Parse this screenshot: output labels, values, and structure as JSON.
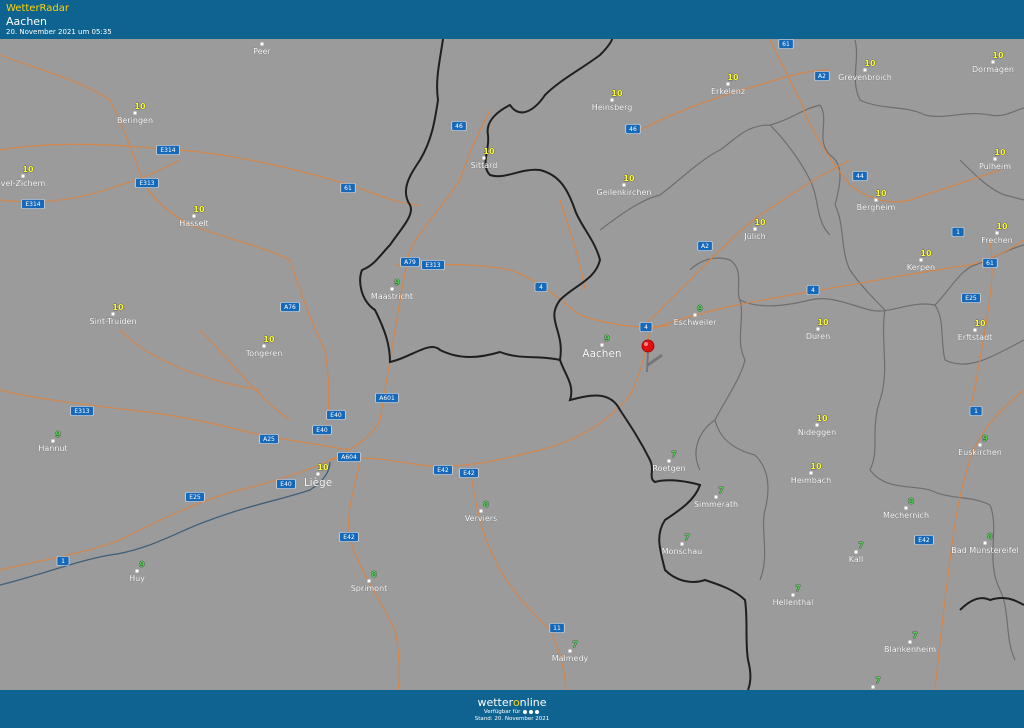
{
  "header": {
    "app_title": "WetterRadar",
    "location": "Aachen",
    "timestamp": "20. November 2021 um 05:35"
  },
  "footer": {
    "brand_left": "wetter",
    "brand_o": "o",
    "brand_right": "nline",
    "available": "Verfügbar für",
    "stand": "Stand: 20. November 2021"
  },
  "colors": {
    "bar": "#0e6390",
    "accent": "#ffd400",
    "value_yellow": "#ffff33",
    "value_green": "#4cd14c",
    "road": "#d4864a",
    "border": "#222222",
    "region": "#6e6e6e"
  },
  "marker_icon": "map-pin-icon",
  "cities": [
    {
      "name": "Peer",
      "value": ""
    },
    {
      "name": "Beringen",
      "value": "10"
    },
    {
      "name": "vel-Zichem",
      "value": "10"
    },
    {
      "name": "Hasselt",
      "value": "10"
    },
    {
      "name": "Sint-Truiden",
      "value": "10"
    },
    {
      "name": "Tongeren",
      "value": "10"
    },
    {
      "name": "Hannut",
      "value": "9"
    },
    {
      "name": "Huy",
      "value": "9"
    },
    {
      "name": "Liège",
      "value": "10"
    },
    {
      "name": "Sprimont",
      "value": "8"
    },
    {
      "name": "Verviers",
      "value": "8"
    },
    {
      "name": "Malmedy",
      "value": "7"
    },
    {
      "name": "Maastricht",
      "value": "9"
    },
    {
      "name": "Sittard",
      "value": "10"
    },
    {
      "name": "Heinsberg",
      "value": "10"
    },
    {
      "name": "Geilenkirchen",
      "value": "10"
    },
    {
      "name": "Erkelenz",
      "value": "10"
    },
    {
      "name": "Grevenbroich",
      "value": "10"
    },
    {
      "name": "Dormagen",
      "value": "10"
    },
    {
      "name": "Pulheim",
      "value": "10"
    },
    {
      "name": "Bergheim",
      "value": "10"
    },
    {
      "name": "Frechen",
      "value": "10"
    },
    {
      "name": "Kerpen",
      "value": "10"
    },
    {
      "name": "Jülich",
      "value": "10"
    },
    {
      "name": "Eschweiler",
      "value": "9"
    },
    {
      "name": "Aachen",
      "value": "9"
    },
    {
      "name": "Düren",
      "value": "10"
    },
    {
      "name": "Erftstadt",
      "value": "10"
    },
    {
      "name": "Nideggen",
      "value": "10"
    },
    {
      "name": "Heimbach",
      "value": "10"
    },
    {
      "name": "Roetgen",
      "value": "7"
    },
    {
      "name": "Simmerath",
      "value": "7"
    },
    {
      "name": "Monschau",
      "value": "7"
    },
    {
      "name": "Hellenthal",
      "value": "7"
    },
    {
      "name": "Euskirchen",
      "value": "9"
    },
    {
      "name": "Mechernich",
      "value": "8"
    },
    {
      "name": "Kall",
      "value": "7"
    },
    {
      "name": "Bad Münstereifel",
      "value": "8"
    },
    {
      "name": "Blankenheim",
      "value": "7"
    },
    {
      "name": "",
      "value": "7"
    }
  ],
  "road_signs": [
    "61",
    "46",
    "A2",
    "46",
    "E314",
    "E313",
    "E314",
    "61",
    "44",
    "A2",
    "A79",
    "E313",
    "A76",
    "4",
    "4",
    "4",
    "1",
    "61",
    "E25",
    "A601",
    "E40",
    "E313",
    "E40",
    "A25",
    "A604",
    "E40",
    "E42",
    "E42",
    "E25",
    "E42",
    "1",
    "E42",
    "1",
    "11"
  ]
}
